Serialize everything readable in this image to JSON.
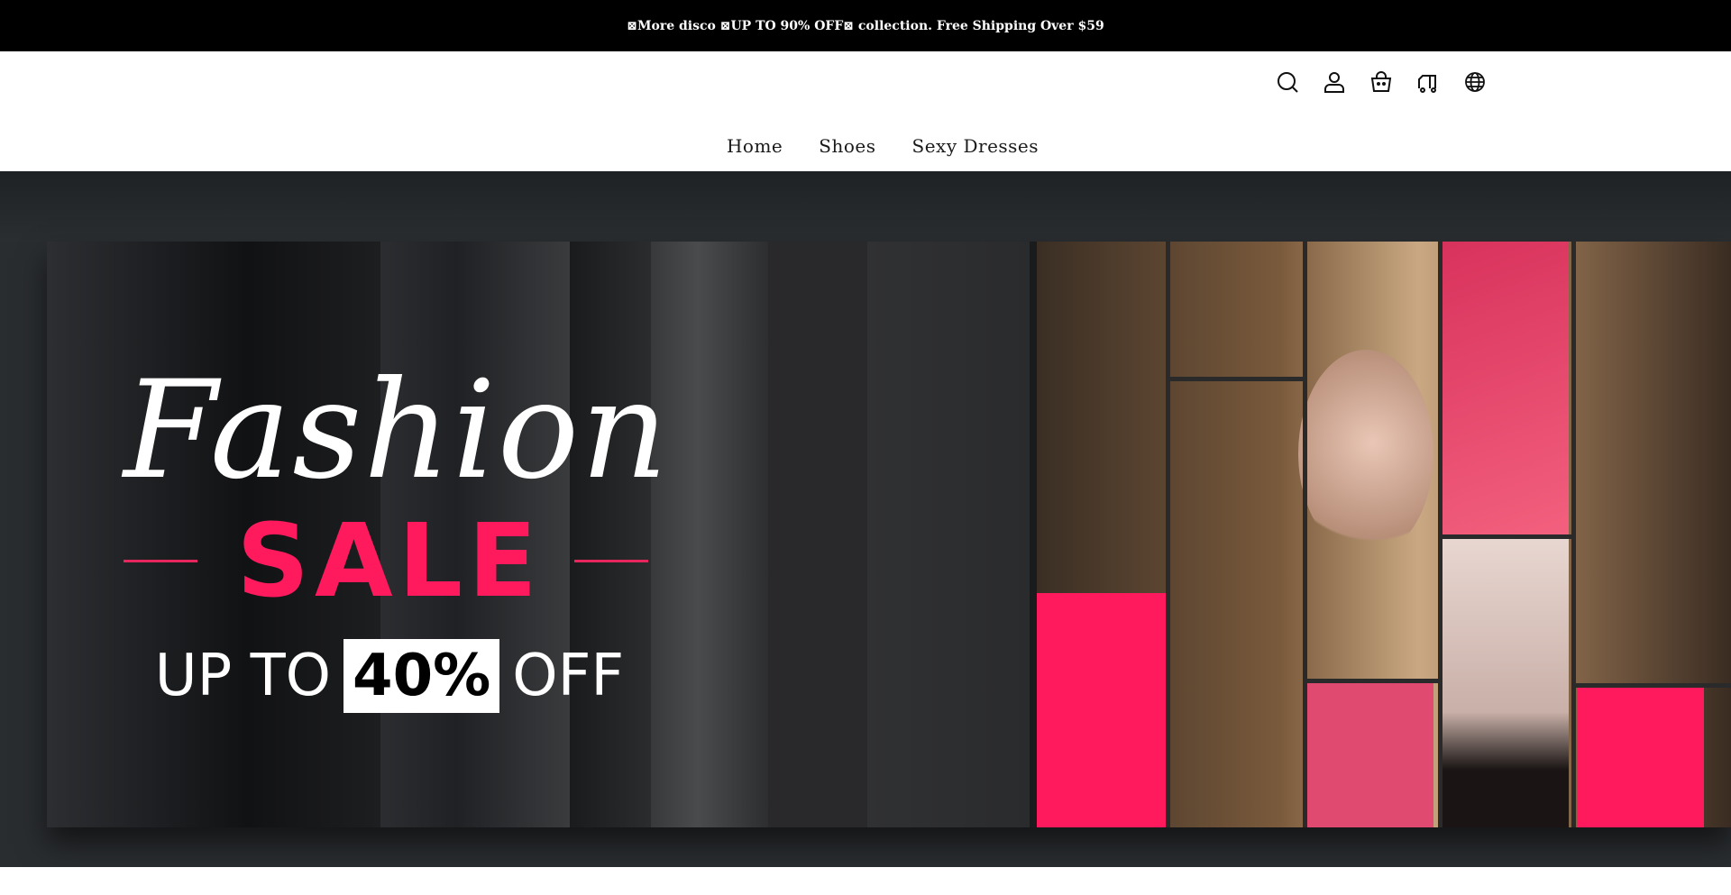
{
  "announcement": {
    "text": "⊠More disco ⊠UP TO 90% OFF⊠ collection. Free Shipping Over $59"
  },
  "header": {
    "icons": [
      "search-icon",
      "account-icon",
      "cart-icon",
      "order-tracking-icon",
      "language-icon"
    ]
  },
  "nav": {
    "items": [
      {
        "label": "Home"
      },
      {
        "label": "Shoes"
      },
      {
        "label": "Sexy Dresses"
      }
    ]
  },
  "hero": {
    "script_title": "Fashion",
    "headline": "SALE",
    "offer_prefix": "UP TO",
    "offer_value": "40%",
    "offer_suffix": "OFF",
    "colors": {
      "accent_pink": "#ff1a5e",
      "background": "#2a2d30",
      "banner_dark": "#1a1b1d"
    }
  }
}
